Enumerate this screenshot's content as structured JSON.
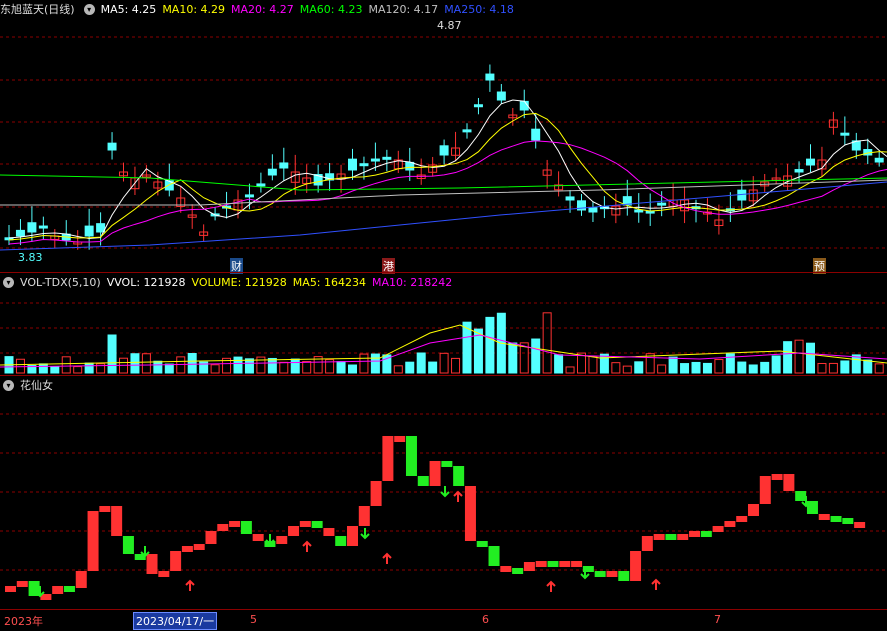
{
  "main": {
    "stock_name": "东旭蓝天(日线)",
    "ma_labels": [
      {
        "text": "MA5: 4.25",
        "color": "#ffffff"
      },
      {
        "text": "MA10: 4.29",
        "color": "#ffff00"
      },
      {
        "text": "MA20: 4.27",
        "color": "#ff00ff"
      },
      {
        "text": "MA60: 4.23",
        "color": "#00ff00"
      },
      {
        "text": "MA120: 4.17",
        "color": "#c0c0c0"
      },
      {
        "text": "MA250: 4.18",
        "color": "#3050ff"
      }
    ],
    "high_label": "4.87",
    "low_label": "3.83",
    "markers": [
      {
        "text": "财",
        "color": "#ffffff",
        "bg": "#1a4a8a"
      },
      {
        "text": "港",
        "color": "#ffffff",
        "bg": "#8a1a1a"
      },
      {
        "text": "预",
        "color": "#ffffff",
        "bg": "#8a5a1a"
      }
    ]
  },
  "volume": {
    "title": "VOL-TDX(5,10)",
    "labels": [
      {
        "text": "VVOL: 121928",
        "color": "#ffffff"
      },
      {
        "text": "VOLUME: 121928",
        "color": "#ffff00"
      },
      {
        "text": "MA5: 164234",
        "color": "#ffff00"
      },
      {
        "text": "MA10: 218242",
        "color": "#ff00ff"
      }
    ]
  },
  "indicator": {
    "title": "花仙女"
  },
  "axis": {
    "labels": [
      "2023年",
      "2023/04/17/一",
      "5",
      "6",
      "7"
    ]
  },
  "colors": {
    "up": "#ff3232",
    "down": "#54ffff",
    "grid": "#8b0000"
  }
}
